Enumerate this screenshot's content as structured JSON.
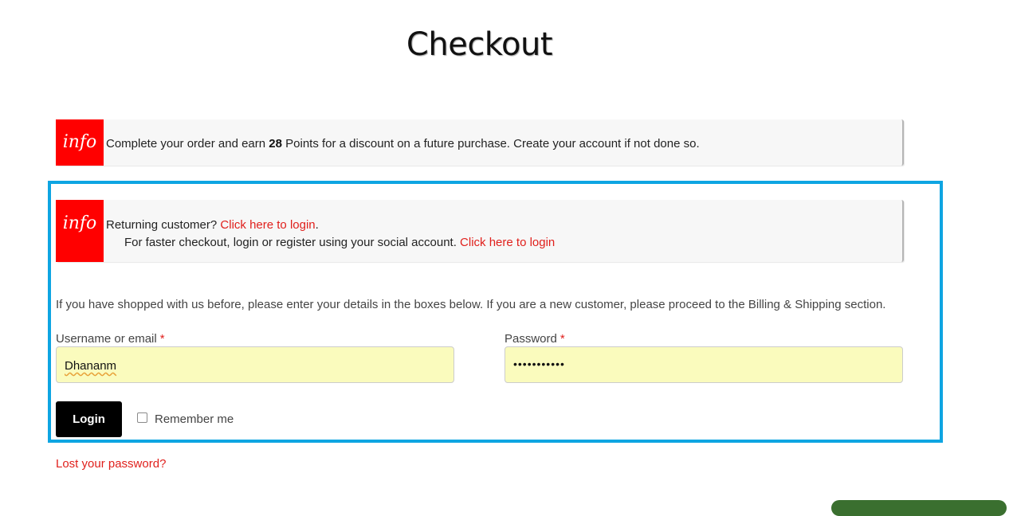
{
  "page": {
    "title": "Checkout"
  },
  "points_notice": {
    "badge": "info",
    "text_before": "Complete your order and earn ",
    "points": "28",
    "text_after": " Points for a discount on a future purchase. Create your account if not done so."
  },
  "login_notice": {
    "badge": "info",
    "line1_text": "Returning customer? ",
    "line1_link": "Click here to login",
    "line1_end": ".",
    "line2_text": "For faster checkout, login or register using your social account. ",
    "line2_link": "Click here to login"
  },
  "login_form": {
    "intro": "If you have shopped with us before, please enter your details in the boxes below. If you are a new customer, please proceed to the Billing & Shipping section.",
    "username_label": "Username or email",
    "username_value": "Dhananm",
    "password_label": "Password",
    "password_value": "•••••••••••",
    "required_mark": "*",
    "login_button": "Login",
    "remember_label": "Remember me",
    "lost_password": "Lost your password?"
  },
  "colors": {
    "badge_red": "#ff0000",
    "link_red": "#e0201c",
    "highlight_blue": "#0ea5e2",
    "autofill_yellow": "#fafbbd"
  }
}
